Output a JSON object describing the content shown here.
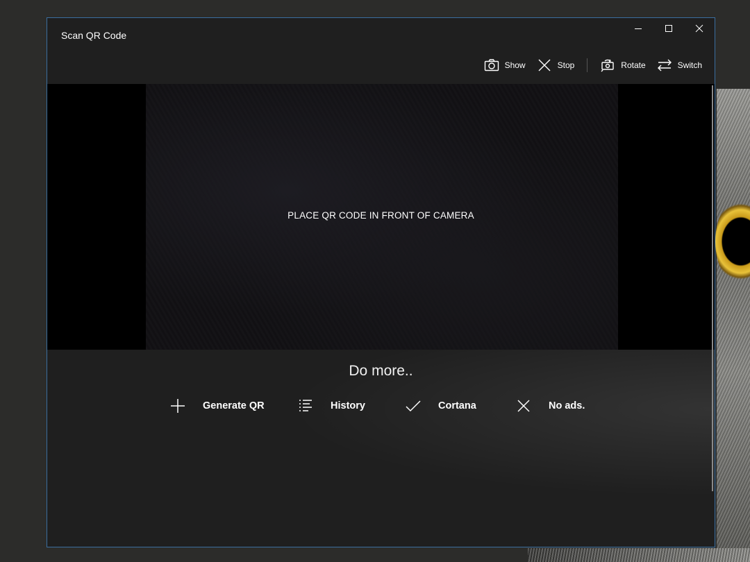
{
  "window": {
    "title": "Scan QR Code"
  },
  "commandbar": {
    "items": [
      {
        "label": "Show",
        "icon": "camera-icon"
      },
      {
        "label": "Stop",
        "icon": "close-icon"
      },
      {
        "label": "Rotate",
        "icon": "rotate-camera-icon"
      },
      {
        "label": "Switch",
        "icon": "switch-arrows-icon"
      }
    ]
  },
  "camera": {
    "hint": "PLACE QR CODE IN FRONT OF CAMERA"
  },
  "more": {
    "heading": "Do more..",
    "actions": [
      {
        "label": "Generate QR",
        "icon": "plus-icon"
      },
      {
        "label": "History",
        "icon": "list-icon"
      },
      {
        "label": "Cortana",
        "icon": "checkmark-icon"
      },
      {
        "label": "No ads.",
        "icon": "close-icon"
      }
    ]
  },
  "colors": {
    "window_border": "#3b6fa0",
    "background": "#1f1f1f",
    "camera_background": "#000000"
  }
}
